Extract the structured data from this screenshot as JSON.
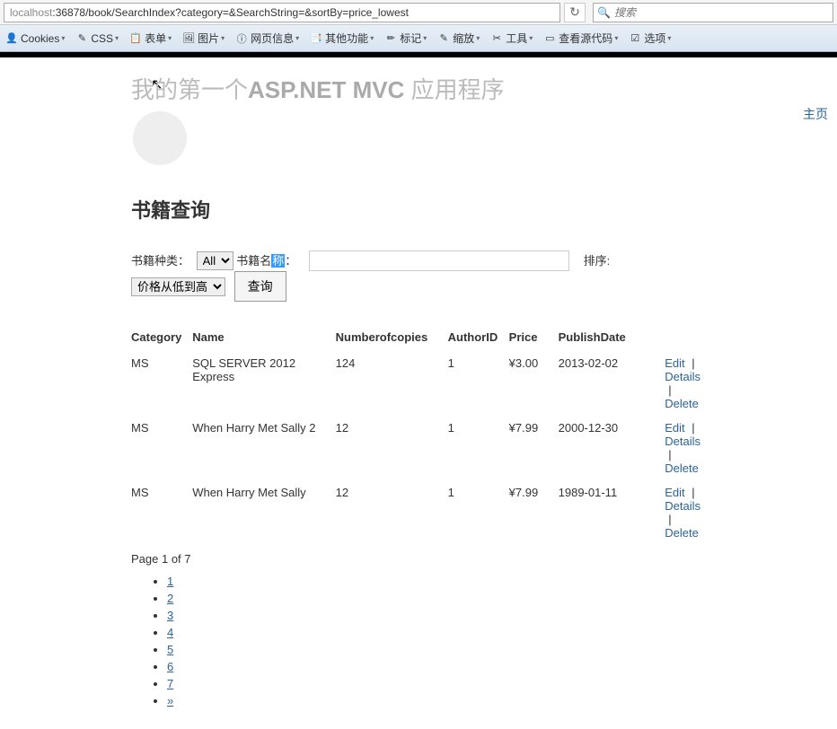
{
  "browser": {
    "url_host": "localhost",
    "url_path": ":36878/book/SearchIndex?category=&SearchString=&sortBy=price_lowest",
    "reload_glyph": "↻",
    "search_placeholder": "搜索"
  },
  "toolbar": [
    {
      "id": "cookies",
      "icon": "👤",
      "label": "Cookies"
    },
    {
      "id": "css",
      "icon": "✎",
      "label": "CSS"
    },
    {
      "id": "forms",
      "icon": "📋",
      "label": "表单"
    },
    {
      "id": "images",
      "icon": "🖼",
      "label": "图片"
    },
    {
      "id": "pageinfo",
      "icon": "ⓘ",
      "label": "网页信息"
    },
    {
      "id": "other",
      "icon": "📑",
      "label": "其他功能"
    },
    {
      "id": "marker",
      "icon": "✏",
      "label": "标记"
    },
    {
      "id": "zoom",
      "icon": "✎",
      "label": "缩放"
    },
    {
      "id": "tools",
      "icon": "✂",
      "label": "工具"
    },
    {
      "id": "source",
      "icon": "▭",
      "label": "查看源代码"
    },
    {
      "id": "options",
      "icon": "☑",
      "label": "选项"
    }
  ],
  "header": {
    "title_prefix": "我的第一个",
    "title_bold": "ASP.NET MVC",
    "title_suffix": " 应用程序",
    "nav_home": "主页"
  },
  "page": {
    "heading": "书籍查询",
    "filter": {
      "category_label": "书籍种类：",
      "category_value": "All",
      "name_label_pre": "书籍名",
      "name_label_hl": "称",
      "name_label_post": "：",
      "name_value": "",
      "sort_label": "排序:",
      "sort_value": "价格从低到高",
      "submit": "查询"
    },
    "table": {
      "headers": {
        "category": "Category",
        "name": "Name",
        "copies": "Numberofcopies",
        "author": "AuthorID",
        "price": "Price",
        "publish": "PublishDate"
      },
      "rows": [
        {
          "category": "MS",
          "name": "SQL SERVER 2012 Express",
          "copies": "124",
          "author": "1",
          "price": "¥3.00",
          "publish": "2013-02-02"
        },
        {
          "category": "MS",
          "name": "When Harry Met Sally 2",
          "copies": "12",
          "author": "1",
          "price": "¥7.99",
          "publish": "2000-12-30"
        },
        {
          "category": "MS",
          "name": "When Harry Met Sally",
          "copies": "12",
          "author": "1",
          "price": "¥7.99",
          "publish": "1989-01-11"
        }
      ],
      "actions": {
        "edit": "Edit",
        "details": "Details",
        "delete": "Delete"
      }
    },
    "pagination": {
      "info": "Page 1 of 7",
      "pages": [
        "1",
        "2",
        "3",
        "4",
        "5",
        "6",
        "7",
        "»"
      ]
    }
  }
}
